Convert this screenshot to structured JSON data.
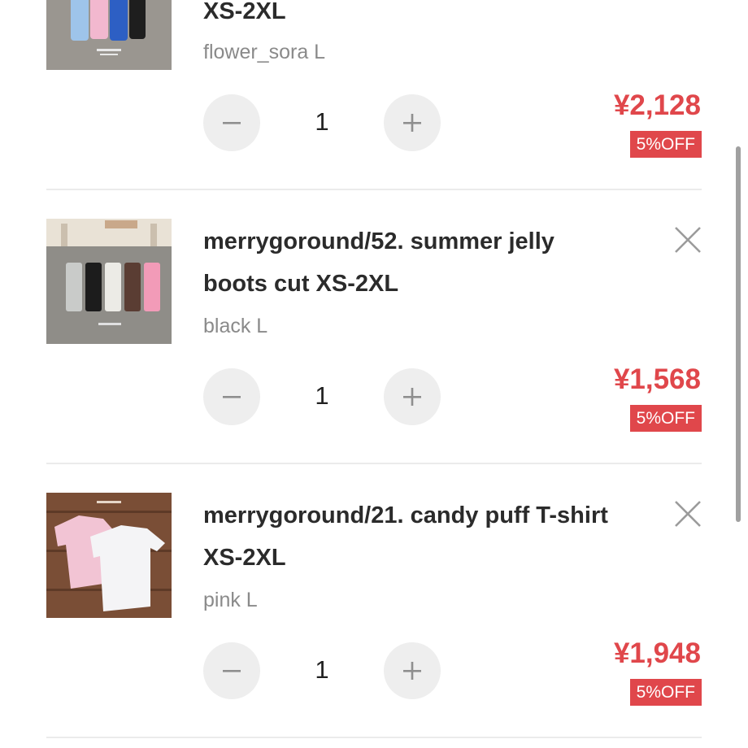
{
  "cart_items": [
    {
      "title": "XS-2XL",
      "variant": "flower_sora L",
      "quantity": "1",
      "price": "¥2,128",
      "discount": "5%OFF",
      "thumb_icon": "product-photo-colorful-boot-cut-pants"
    },
    {
      "title_line1": "merrygoround/52. summer jelly",
      "title_line2": "boots cut XS-2XL",
      "variant": "black L",
      "quantity": "1",
      "price": "¥1,568",
      "discount": "5%OFF",
      "thumb_icon": "product-photo-jelly-boot-cut-pants"
    },
    {
      "title_line1": "merrygoround/21. candy puff T-shirt",
      "title_line2": "XS-2XL",
      "variant": "pink L",
      "quantity": "1",
      "price": "¥1,948",
      "discount": "5%OFF",
      "thumb_icon": "product-photo-puff-tshirts"
    }
  ],
  "icons": {
    "remove": "close-icon",
    "decrease": "minus-icon",
    "increase": "plus-icon"
  },
  "colors": {
    "price": "#e0474b",
    "badge_bg": "#e0474b",
    "qty_button_bg": "#eeeeee",
    "title": "#2b2b2b",
    "variant": "#8a8a8a"
  }
}
